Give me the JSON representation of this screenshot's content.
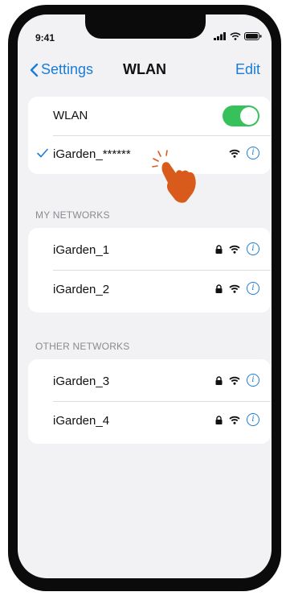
{
  "status_bar": {
    "time": "9:41"
  },
  "nav": {
    "back_label": "Settings",
    "title": "WLAN",
    "edit_label": "Edit"
  },
  "wlan_card": {
    "toggle_label": "WLAN",
    "toggle_on": true,
    "connected_network": "iGarden_******"
  },
  "my_networks": {
    "header": "MY NETWORKS",
    "items": [
      {
        "name": "iGarden_1"
      },
      {
        "name": "iGarden_2"
      }
    ]
  },
  "other_networks": {
    "header": "OTHER NETWORKS",
    "items": [
      {
        "name": "iGarden_3"
      },
      {
        "name": "iGarden_4"
      }
    ]
  },
  "colors": {
    "accent": "#1a7cd6",
    "toggle_on": "#37c15b",
    "hand": "#d95b1c"
  },
  "icons": [
    "back-chevron-icon",
    "wifi-icon",
    "lock-icon",
    "info-icon",
    "checkmark-icon",
    "tap-hand-icon"
  ]
}
